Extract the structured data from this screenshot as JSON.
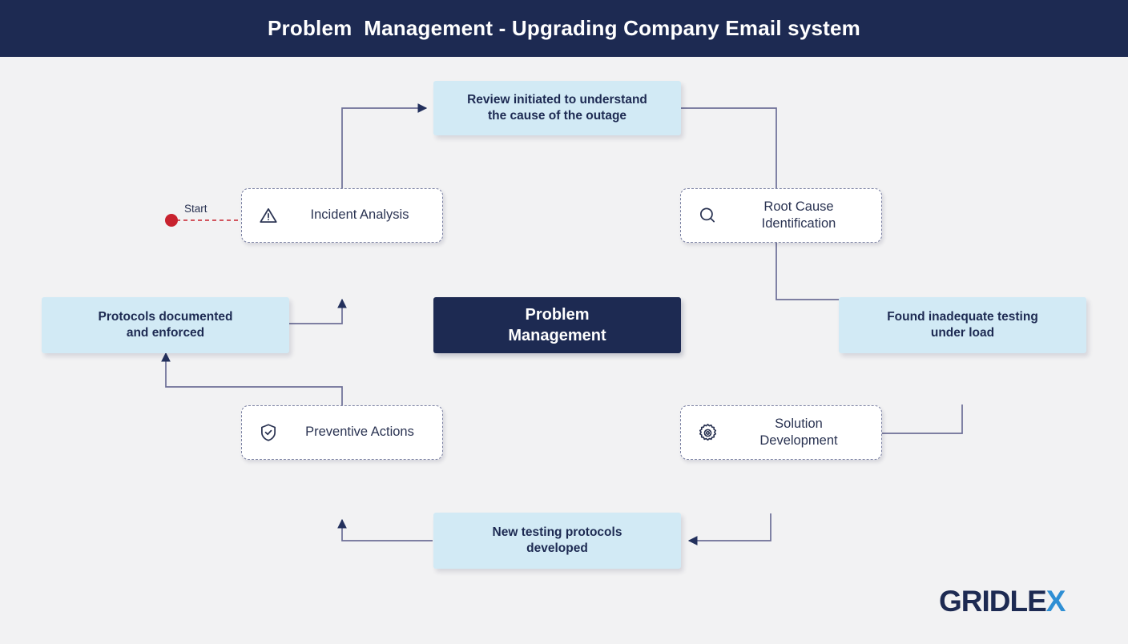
{
  "header": {
    "title": "Problem  Management - Upgrading Company Email system"
  },
  "start": {
    "label": "Start",
    "dot_color": "#c8222e"
  },
  "center": {
    "label": "Problem\nManagement"
  },
  "steps": [
    {
      "id": "incident-analysis",
      "label": "Incident Analysis",
      "icon": "warning-triangle-icon"
    },
    {
      "id": "root-cause",
      "label": "Root Cause\nIdentification",
      "icon": "magnifier-icon"
    },
    {
      "id": "solution-development",
      "label": "Solution\nDevelopment",
      "icon": "gear-icon"
    },
    {
      "id": "preventive-actions",
      "label": "Preventive Actions",
      "icon": "shield-check-icon"
    }
  ],
  "outcomes": [
    {
      "id": "review-initiated",
      "label": "Review initiated to understand\nthe cause of the outage"
    },
    {
      "id": "found-inadequate",
      "label": "Found inadequate testing\nunder load"
    },
    {
      "id": "new-protocols",
      "label": "New testing protocols\ndeveloped"
    },
    {
      "id": "protocols-enforced",
      "label": "Protocols documented\nand enforced"
    }
  ],
  "logo": {
    "text_main": "GRIDLE",
    "text_accent": "X",
    "accent_color": "#2f8fd4",
    "base_color": "#1d2a52"
  },
  "colors": {
    "header_bg": "#1d2a52",
    "canvas_bg": "#f2f2f3",
    "outcome_bg": "#d2eaf5",
    "connector": "#6d6f97",
    "arrow_head": "#23305c",
    "dashed_border": "#7c82a3"
  }
}
